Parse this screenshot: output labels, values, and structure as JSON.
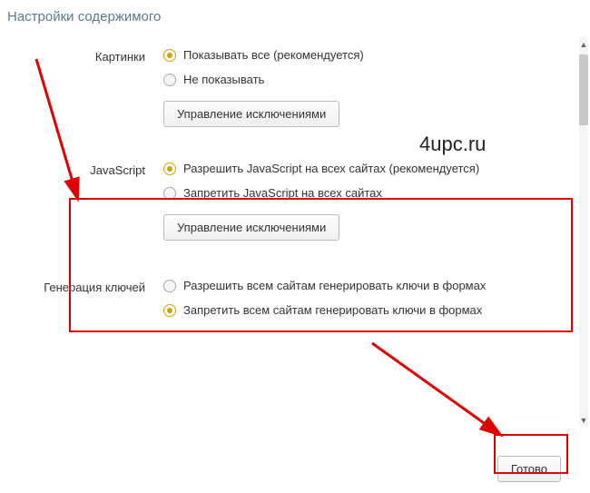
{
  "title": "Настройки содержимого",
  "watermark": "4upc.ru",
  "sections": {
    "images": {
      "label": "Картинки",
      "options": [
        {
          "label": "Показывать все (рекомендуется)",
          "selected": true
        },
        {
          "label": "Не показывать",
          "selected": false
        }
      ],
      "manage_button": "Управление исключениями"
    },
    "javascript": {
      "label": "JavaScript",
      "options": [
        {
          "label": "Разрешить JavaScript на всех сайтах (рекомендуется)",
          "selected": true
        },
        {
          "label": "Запретить JavaScript на всех сайтах",
          "selected": false
        }
      ],
      "manage_button": "Управление исключениями"
    },
    "keygen": {
      "label": "Генерация ключей",
      "options": [
        {
          "label": "Разрешить всем сайтам генерировать ключи в формах",
          "selected": false
        },
        {
          "label": "Запретить всем сайтам генерировать ключи в формах",
          "selected": true
        }
      ]
    }
  },
  "done_button": "Готово"
}
